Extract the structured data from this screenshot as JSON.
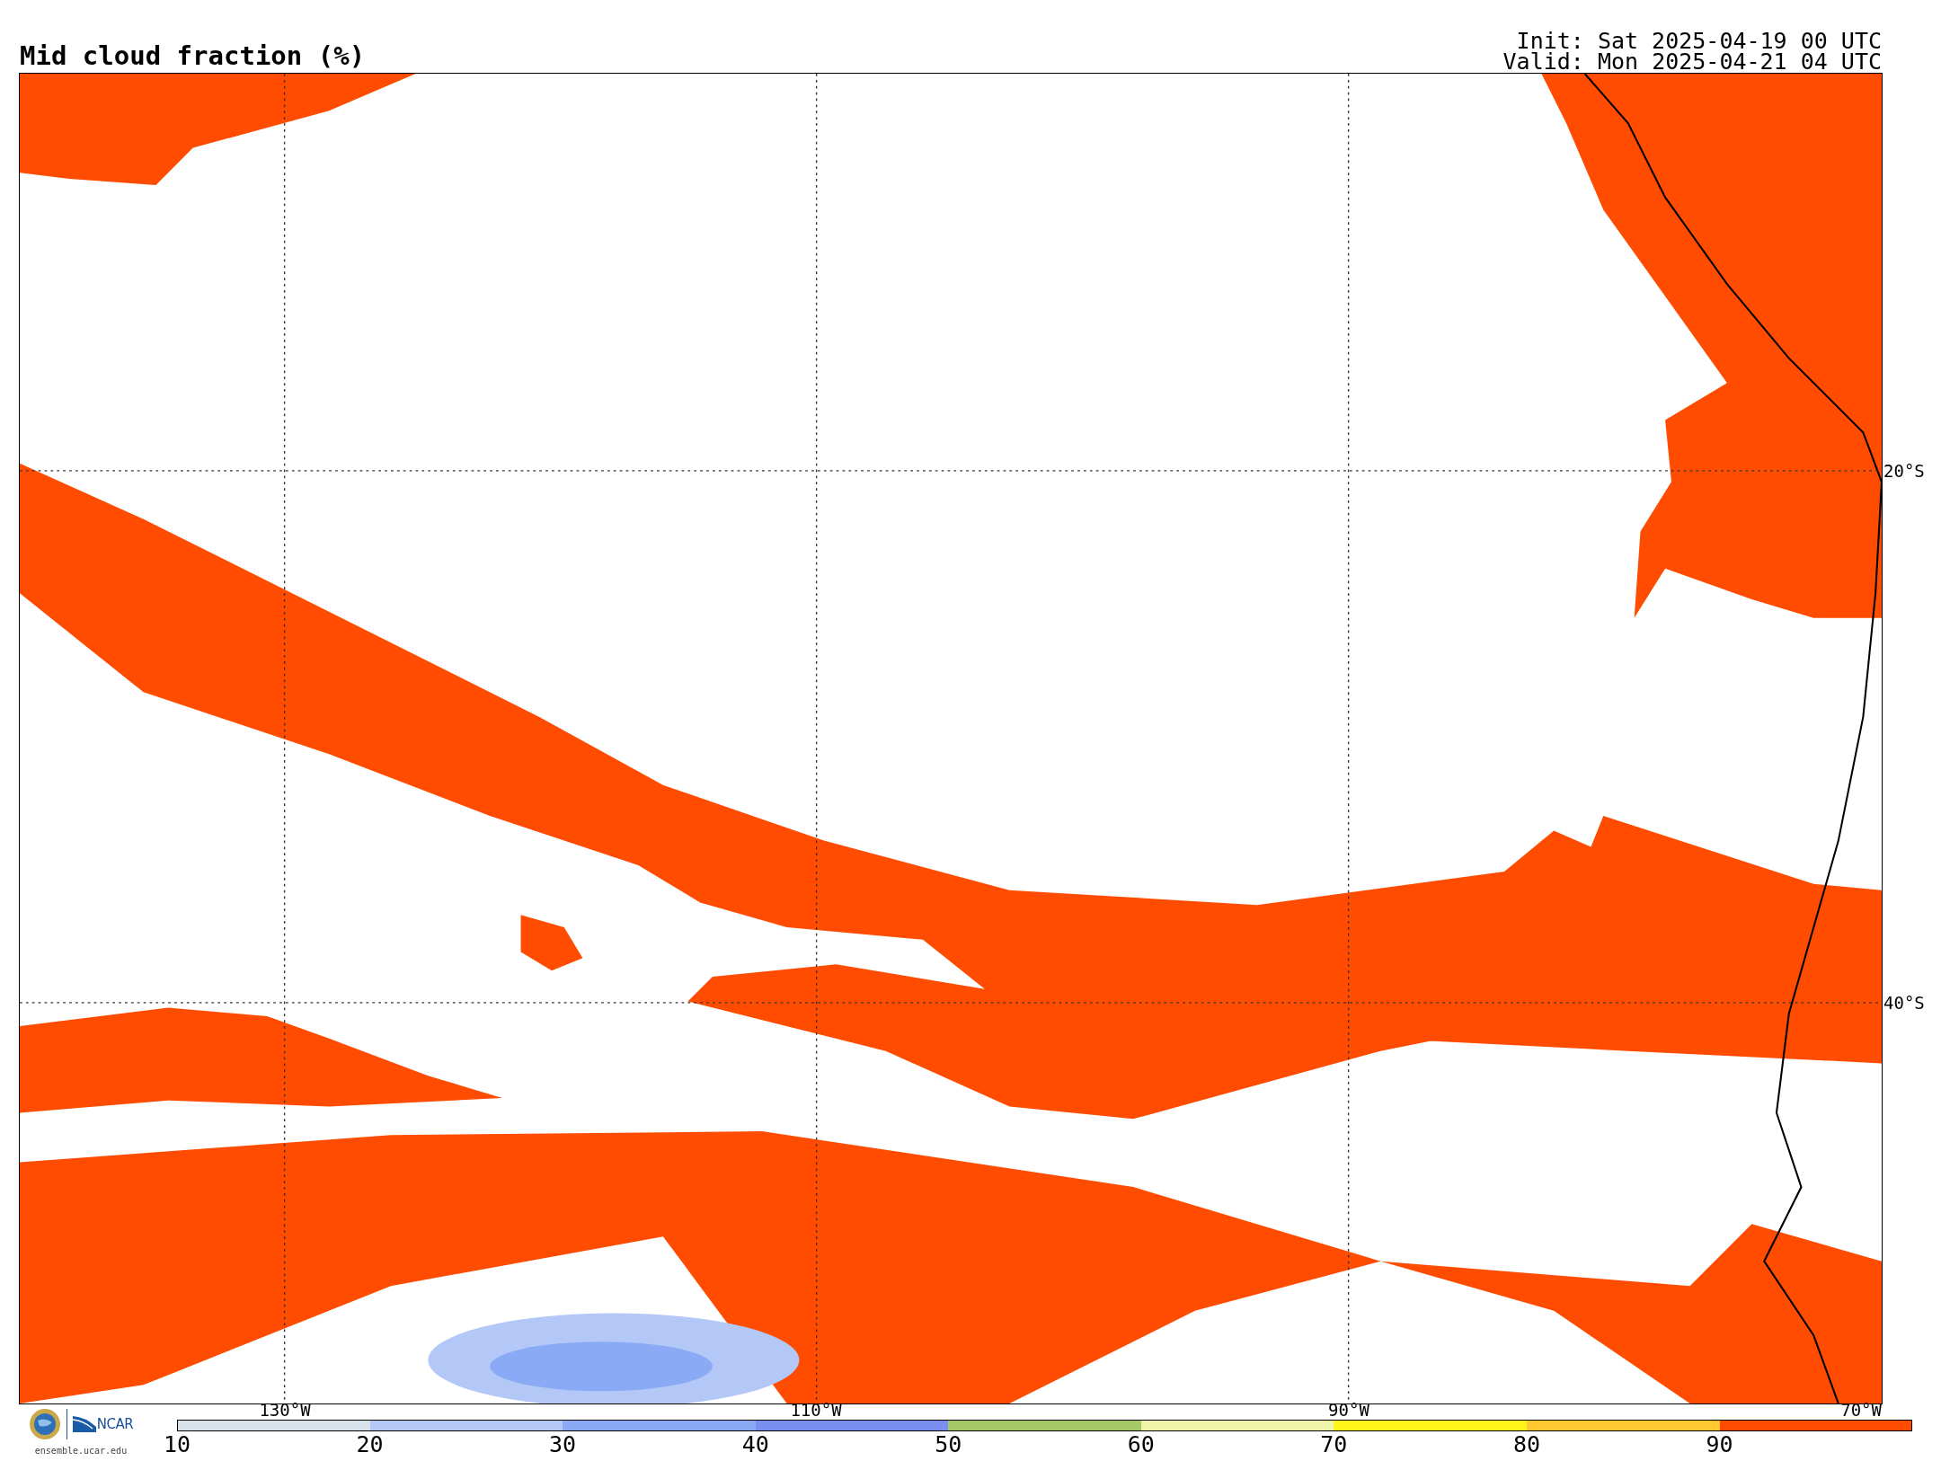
{
  "header": {
    "title": "Mid cloud fraction (%)",
    "init": "Init: Sat 2025-04-19 00 UTC",
    "valid": "Valid: Mon 2025-04-21 04 UTC"
  },
  "map": {
    "longitudes": [
      "130°W",
      "110°W",
      "90°W",
      "70°W"
    ],
    "latitudes": [
      "20°S",
      "40°S"
    ]
  },
  "footer": {
    "org": "NCAR",
    "site": "ensemble.ucar.edu"
  },
  "colorbar": {
    "segments": [
      {
        "color": "#d8e2ea"
      },
      {
        "color": "#b4c8f8"
      },
      {
        "color": "#8aaaf5"
      },
      {
        "color": "#7a8ff0"
      },
      {
        "color": "#a6c865"
      },
      {
        "color": "#eef5a8"
      },
      {
        "color": "#fff51c"
      },
      {
        "color": "#ffc830"
      },
      {
        "color": "#ff4c00"
      }
    ],
    "ticks": [
      "10",
      "20",
      "30",
      "40",
      "50",
      "60",
      "70",
      "80",
      "90"
    ]
  }
}
